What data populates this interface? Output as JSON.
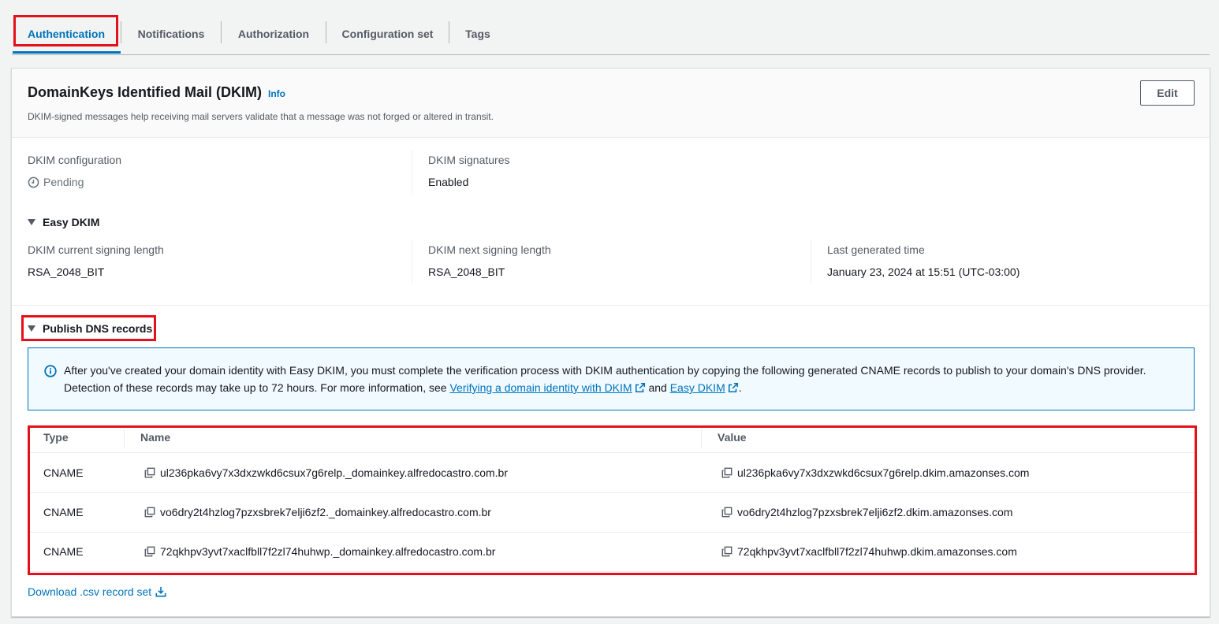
{
  "tabs": [
    {
      "label": "Authentication",
      "active": true
    },
    {
      "label": "Notifications",
      "active": false
    },
    {
      "label": "Authorization",
      "active": false
    },
    {
      "label": "Configuration set",
      "active": false
    },
    {
      "label": "Tags",
      "active": false
    }
  ],
  "panel": {
    "title": "DomainKeys Identified Mail (DKIM)",
    "info_label": "Info",
    "description": "DKIM-signed messages help receiving mail servers validate that a message was not forged or altered in transit.",
    "edit_label": "Edit"
  },
  "dkim": {
    "config_label": "DKIM configuration",
    "config_value": "Pending",
    "signatures_label": "DKIM signatures",
    "signatures_value": "Enabled"
  },
  "easy_dkim": {
    "heading": "Easy DKIM",
    "current_len_label": "DKIM current signing length",
    "current_len_value": "RSA_2048_BIT",
    "next_len_label": "DKIM next signing length",
    "next_len_value": "RSA_2048_BIT",
    "last_gen_label": "Last generated time",
    "last_gen_value": "January 23, 2024 at 15:51 (UTC-03:00)"
  },
  "publish": {
    "heading": "Publish DNS records",
    "alert_text_1": "After you've created your domain identity with Easy DKIM, you must complete the verification process with DKIM authentication by copying the following generated CNAME records to publish to your domain's DNS provider. Detection of these records may take up to 72 hours. For more information, see ",
    "alert_link_1": "Verifying a domain identity with DKIM",
    "alert_and": " and ",
    "alert_link_2": "Easy DKIM",
    "alert_end": "."
  },
  "table": {
    "headers": {
      "type": "Type",
      "name": "Name",
      "value": "Value"
    },
    "rows": [
      {
        "type": "CNAME",
        "name": "ul236pka6vy7x3dxzwkd6csux7g6relp._domainkey.alfredocastro.com.br",
        "value": "ul236pka6vy7x3dxzwkd6csux7g6relp.dkim.amazonses.com"
      },
      {
        "type": "CNAME",
        "name": "vo6dry2t4hzlog7pzxsbrek7elji6zf2._domainkey.alfredocastro.com.br",
        "value": "vo6dry2t4hzlog7pzxsbrek7elji6zf2.dkim.amazonses.com"
      },
      {
        "type": "CNAME",
        "name": "72qkhpv3yvt7xaclfbll7f2zl74huhwp._domainkey.alfredocastro.com.br",
        "value": "72qkhpv3yvt7xaclfbll7f2zl74huhwp.dkim.amazonses.com"
      }
    ]
  },
  "download_label": "Download .csv record set",
  "colors": {
    "accent": "#0073bb",
    "highlight": "#e3121a",
    "alert_bg": "#f1faff"
  },
  "icons": [
    "clock-icon",
    "info-icon",
    "external-link-icon",
    "copy-icon",
    "download-icon",
    "caret-down-icon"
  ]
}
